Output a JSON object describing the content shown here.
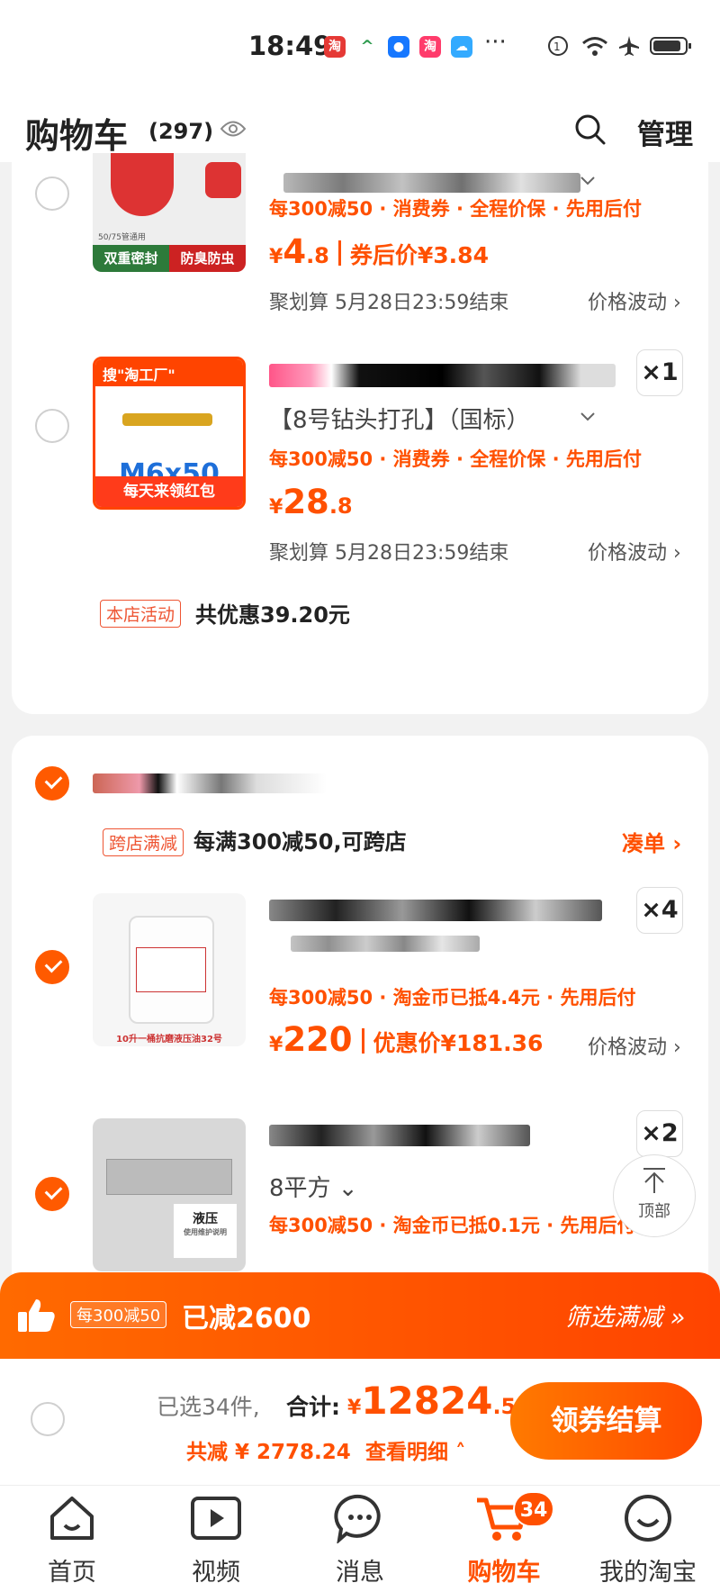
{
  "status_bar": {
    "time": "18:49",
    "app1": "淘",
    "app3": "淘",
    "more": "···"
  },
  "header": {
    "title": "购物车",
    "count": "(297)",
    "manage": "管理"
  },
  "store1": {
    "item1": {
      "thumb_left": "双重密封",
      "thumb_right": "防臭防虫",
      "thumb_note": "50/75管通用",
      "promo": "每300减50 · 消费券 · 全程价保 · 先用后付",
      "currency": "¥",
      "price_big": "4",
      "price_dec": ".8",
      "after_label": "券后价¥3.84",
      "deal": "聚划算 5月28日23:59结束",
      "trend": "价格波动"
    },
    "item2": {
      "thumb_brand": "搜\"淘工厂\"",
      "thumb_sub": "M6x50",
      "thumb_footer": "每天来领红包",
      "qty": "×1",
      "spec": "【8号钻头打孔】（国标）",
      "promo": "每300减50 · 消费券 · 全程价保 · 先用后付",
      "currency": "¥",
      "price_big": "28",
      "price_dec": ".8",
      "deal": "聚划算 5月28日23:59结束",
      "trend": "价格波动"
    },
    "activity_tag": "本店活动",
    "activity_text": "共优惠39.20元"
  },
  "store2": {
    "cross_tag": "跨店满减",
    "cross_text": "每满300减50,可跨店",
    "cross_link": "凑单",
    "item1": {
      "thumb_caption": "10升一桶抗磨液压油32号",
      "qty": "×4",
      "promo": "每300减50 · 淘金币已抵4.4元 · 先用后付",
      "currency": "¥",
      "price_big": "220",
      "after_label": "优惠价¥181.36",
      "trend": "价格波动"
    },
    "item2": {
      "thumb_label": "液压",
      "thumb_sub": "使用维护说明",
      "qty": "×2",
      "spec": "8平方",
      "promo": "每300减50 · 淘金币已抵0.1元 · 先用后付"
    }
  },
  "top_button": "顶部",
  "banner": {
    "badge": "每300减50",
    "text": "已减2600",
    "filter": "筛选满减"
  },
  "checkout": {
    "selected": "已选34件,",
    "total_label": "合计:",
    "currency": "¥",
    "total_big": "12824",
    "total_dec": ".56",
    "saved": "共减 ¥ 2778.24",
    "detail": "查看明细",
    "button": "领券结算"
  },
  "tabs": [
    {
      "label": "首页"
    },
    {
      "label": "视频"
    },
    {
      "label": "消息"
    },
    {
      "label": "购物车",
      "badge": "34"
    },
    {
      "label": "我的淘宝"
    }
  ]
}
